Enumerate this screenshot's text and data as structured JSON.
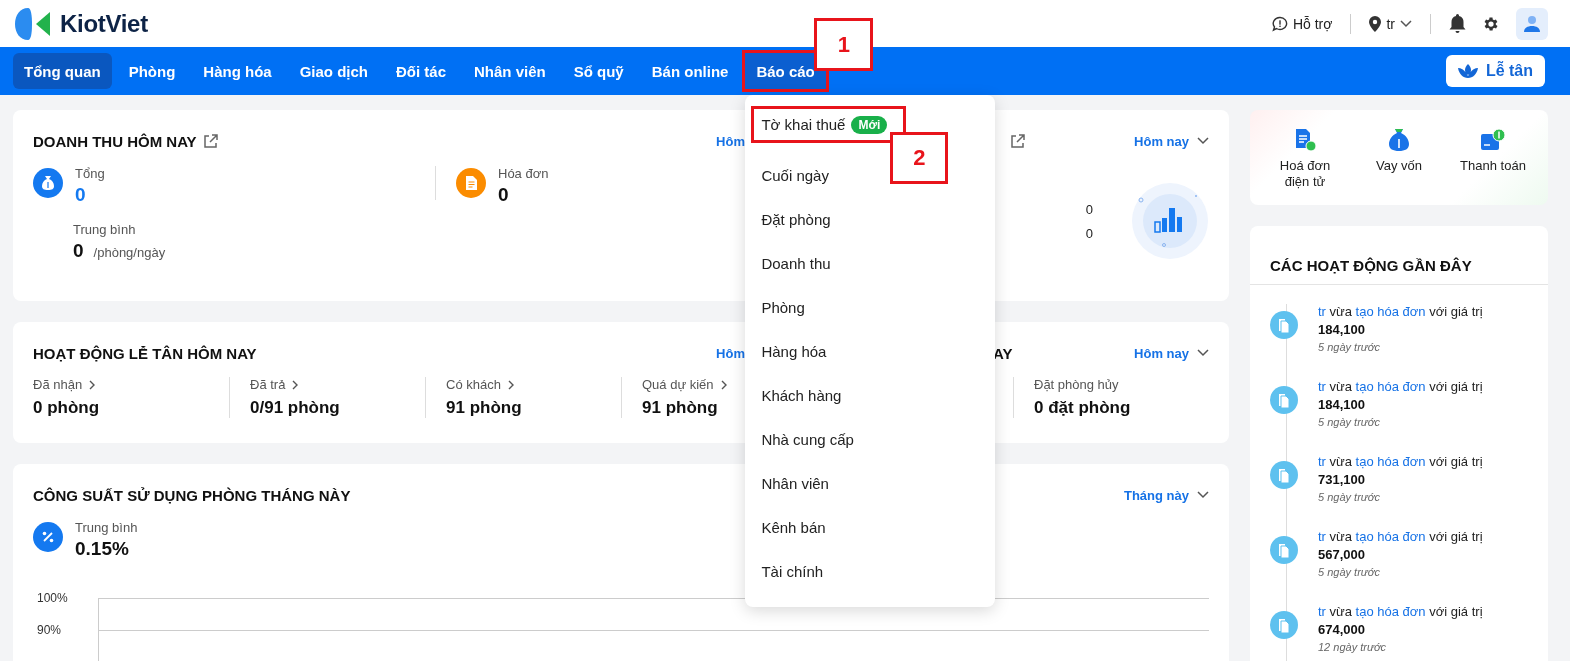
{
  "header": {
    "logo_text": "KiotViet",
    "support": "Hỗ trợ",
    "branch": "tr"
  },
  "nav": {
    "items": [
      {
        "label": "Tổng quan",
        "selected": true,
        "expanded": false
      },
      {
        "label": "Phòng",
        "selected": false,
        "expanded": false
      },
      {
        "label": "Hàng hóa",
        "selected": false,
        "expanded": false
      },
      {
        "label": "Giao dịch",
        "selected": false,
        "expanded": false
      },
      {
        "label": "Đối tác",
        "selected": false,
        "expanded": false
      },
      {
        "label": "Nhân viên",
        "selected": false,
        "expanded": false
      },
      {
        "label": "Sổ quỹ",
        "selected": false,
        "expanded": false
      },
      {
        "label": "Bán online",
        "selected": false,
        "expanded": false
      },
      {
        "label": "Báo cáo",
        "selected": false,
        "expanded": true,
        "callout": "1"
      }
    ],
    "reception_button": "Lễ tân"
  },
  "report_menu": [
    {
      "label": "Tờ khai thuế",
      "badge": "Mới",
      "callout": "2"
    },
    {
      "label": "Cuối ngày"
    },
    {
      "label": "Đặt phòng"
    },
    {
      "label": "Doanh thu"
    },
    {
      "label": "Phòng"
    },
    {
      "label": "Hàng hóa"
    },
    {
      "label": "Khách hàng"
    },
    {
      "label": "Nhà cung cấp"
    },
    {
      "label": "Nhân viên"
    },
    {
      "label": "Kênh bán"
    },
    {
      "label": "Tài chính"
    }
  ],
  "revenue_card": {
    "title": "DOANH THU HÔM NAY",
    "period_cut": "Hôm",
    "stats": [
      {
        "kind": "money",
        "label": "Tổng",
        "value": "0"
      },
      {
        "kind": "invoice",
        "label": "Hóa đơn",
        "value": "0"
      }
    ],
    "average": {
      "label": "Trung bình",
      "value": "0",
      "unit": "/phòng/ngày"
    },
    "right_period": "Hôm nay",
    "right_values": [
      "0",
      "0"
    ]
  },
  "reception_card": {
    "title": "HOẠT ĐỘNG LỄ TÂN HÔM NAY",
    "period_cut": "Hôm",
    "right_title_cut": "AY",
    "right_period": "Hôm nay",
    "stats": [
      {
        "label": "Đã nhận",
        "value": "0 phòng",
        "link": true
      },
      {
        "label": "Đã trả",
        "value": "0/91 phòng",
        "link": true
      },
      {
        "label": "Có khách",
        "value": "91 phòng",
        "link": true
      },
      {
        "label": "Quá dự kiến",
        "value": "91 phòng",
        "link": true
      },
      {
        "label": "Đặt phòng hủy",
        "value": "0 đặt phòng",
        "link": false
      }
    ]
  },
  "occupancy_card": {
    "title": "CÔNG SUẤT SỬ DỤNG PHÒNG THÁNG NÀY",
    "period": "Tháng này",
    "average_label": "Trung bình",
    "average_value": "0.15%",
    "y_tick_labels": [
      "100%",
      "90%"
    ]
  },
  "quick_actions": [
    {
      "kind": "einvoice",
      "label": "Hoá đơn điện tử"
    },
    {
      "kind": "loan",
      "label": "Vay vốn"
    },
    {
      "kind": "payment",
      "label": "Thanh toán"
    }
  ],
  "activity": {
    "title": "CÁC HOẠT ĐỘNG GẦN ĐÂY",
    "items": [
      {
        "user": "tr",
        "verb": "vừa",
        "action": "tạo hóa đơn",
        "suffix": "với giá trị",
        "amount": "184,100",
        "time": "5 ngày trước"
      },
      {
        "user": "tr",
        "verb": "vừa",
        "action": "tạo hóa đơn",
        "suffix": "với giá trị",
        "amount": "184,100",
        "time": "5 ngày trước"
      },
      {
        "user": "tr",
        "verb": "vừa",
        "action": "tạo hóa đơn",
        "suffix": "với giá trị",
        "amount": "731,100",
        "time": "5 ngày trước"
      },
      {
        "user": "tr",
        "verb": "vừa",
        "action": "tạo hóa đơn",
        "suffix": "với giá trị",
        "amount": "567,000",
        "time": "5 ngày trước"
      },
      {
        "user": "tr",
        "verb": "vừa",
        "action": "tạo hóa đơn",
        "suffix": "với giá trị",
        "amount": "674,000",
        "time": "12 ngày trước"
      }
    ]
  }
}
